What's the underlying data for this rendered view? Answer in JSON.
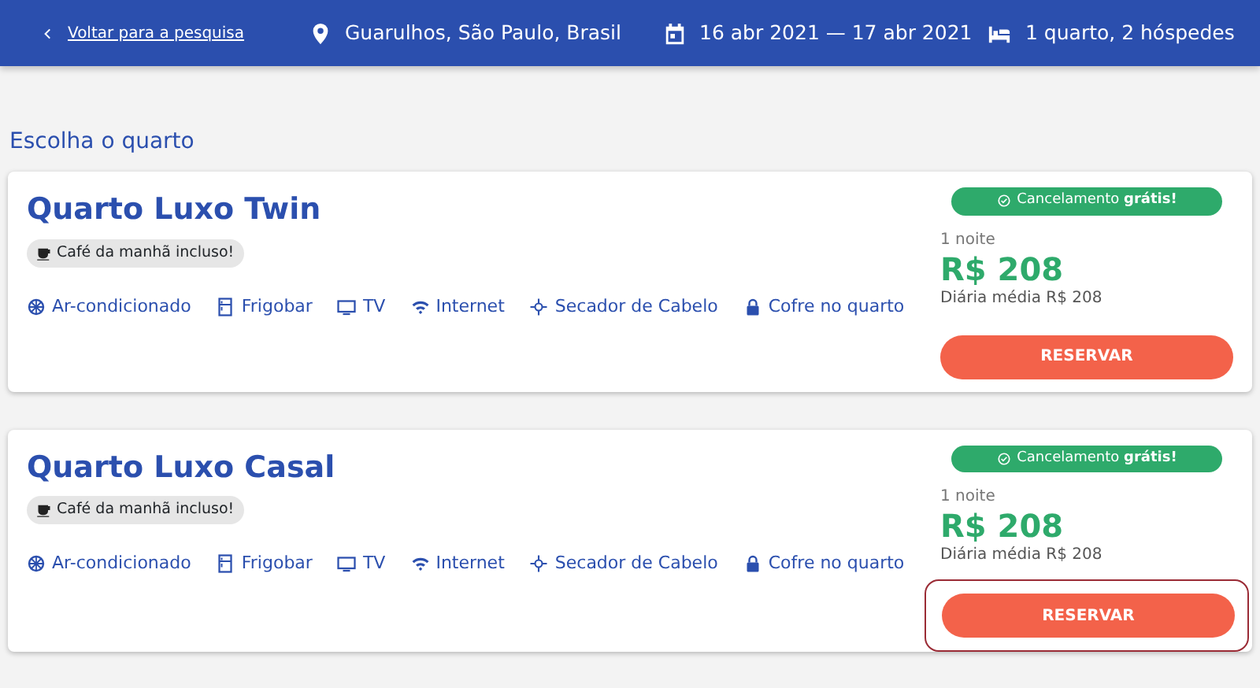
{
  "header": {
    "back_link": "Voltar para a pesquisa",
    "location": "Guarulhos, São Paulo, Brasil",
    "dates": "16 abr 2021 — 17 abr 2021",
    "guests": "1 quarto, 2 hóspedes"
  },
  "section_title": "Escolha o quarto",
  "rooms": [
    {
      "name": "Quarto Luxo Twin",
      "breakfast": "Café da manhã incluso!",
      "amenities": [
        {
          "kind": "ac",
          "label": "Ar-condicionado"
        },
        {
          "kind": "fridge",
          "label": "Frigobar"
        },
        {
          "kind": "tv",
          "label": "TV"
        },
        {
          "kind": "wifi",
          "label": "Internet"
        },
        {
          "kind": "dryer",
          "label": "Secador de Cabelo"
        },
        {
          "kind": "safe",
          "label": "Cofre no quarto"
        }
      ],
      "cancellation": "Cancelamento **grátis!**",
      "nights": "1 noite",
      "price": "R$ 208",
      "average": "Diária média R$ 208",
      "button": "RESERVAR",
      "highlighted": false
    },
    {
      "name": "Quarto Luxo Casal",
      "breakfast": "Café da manhã incluso!",
      "amenities": [
        {
          "kind": "ac",
          "label": "Ar-condicionado"
        },
        {
          "kind": "fridge",
          "label": "Frigobar"
        },
        {
          "kind": "tv",
          "label": "TV"
        },
        {
          "kind": "wifi",
          "label": "Internet"
        },
        {
          "kind": "dryer",
          "label": "Secador de Cabelo"
        },
        {
          "kind": "safe",
          "label": "Cofre no quarto"
        }
      ],
      "cancellation": "Cancelamento **grátis!**",
      "nights": "1 noite",
      "price": "R$ 208",
      "average": "Diária média R$ 208",
      "button": "RESERVAR",
      "highlighted": true
    }
  ]
}
